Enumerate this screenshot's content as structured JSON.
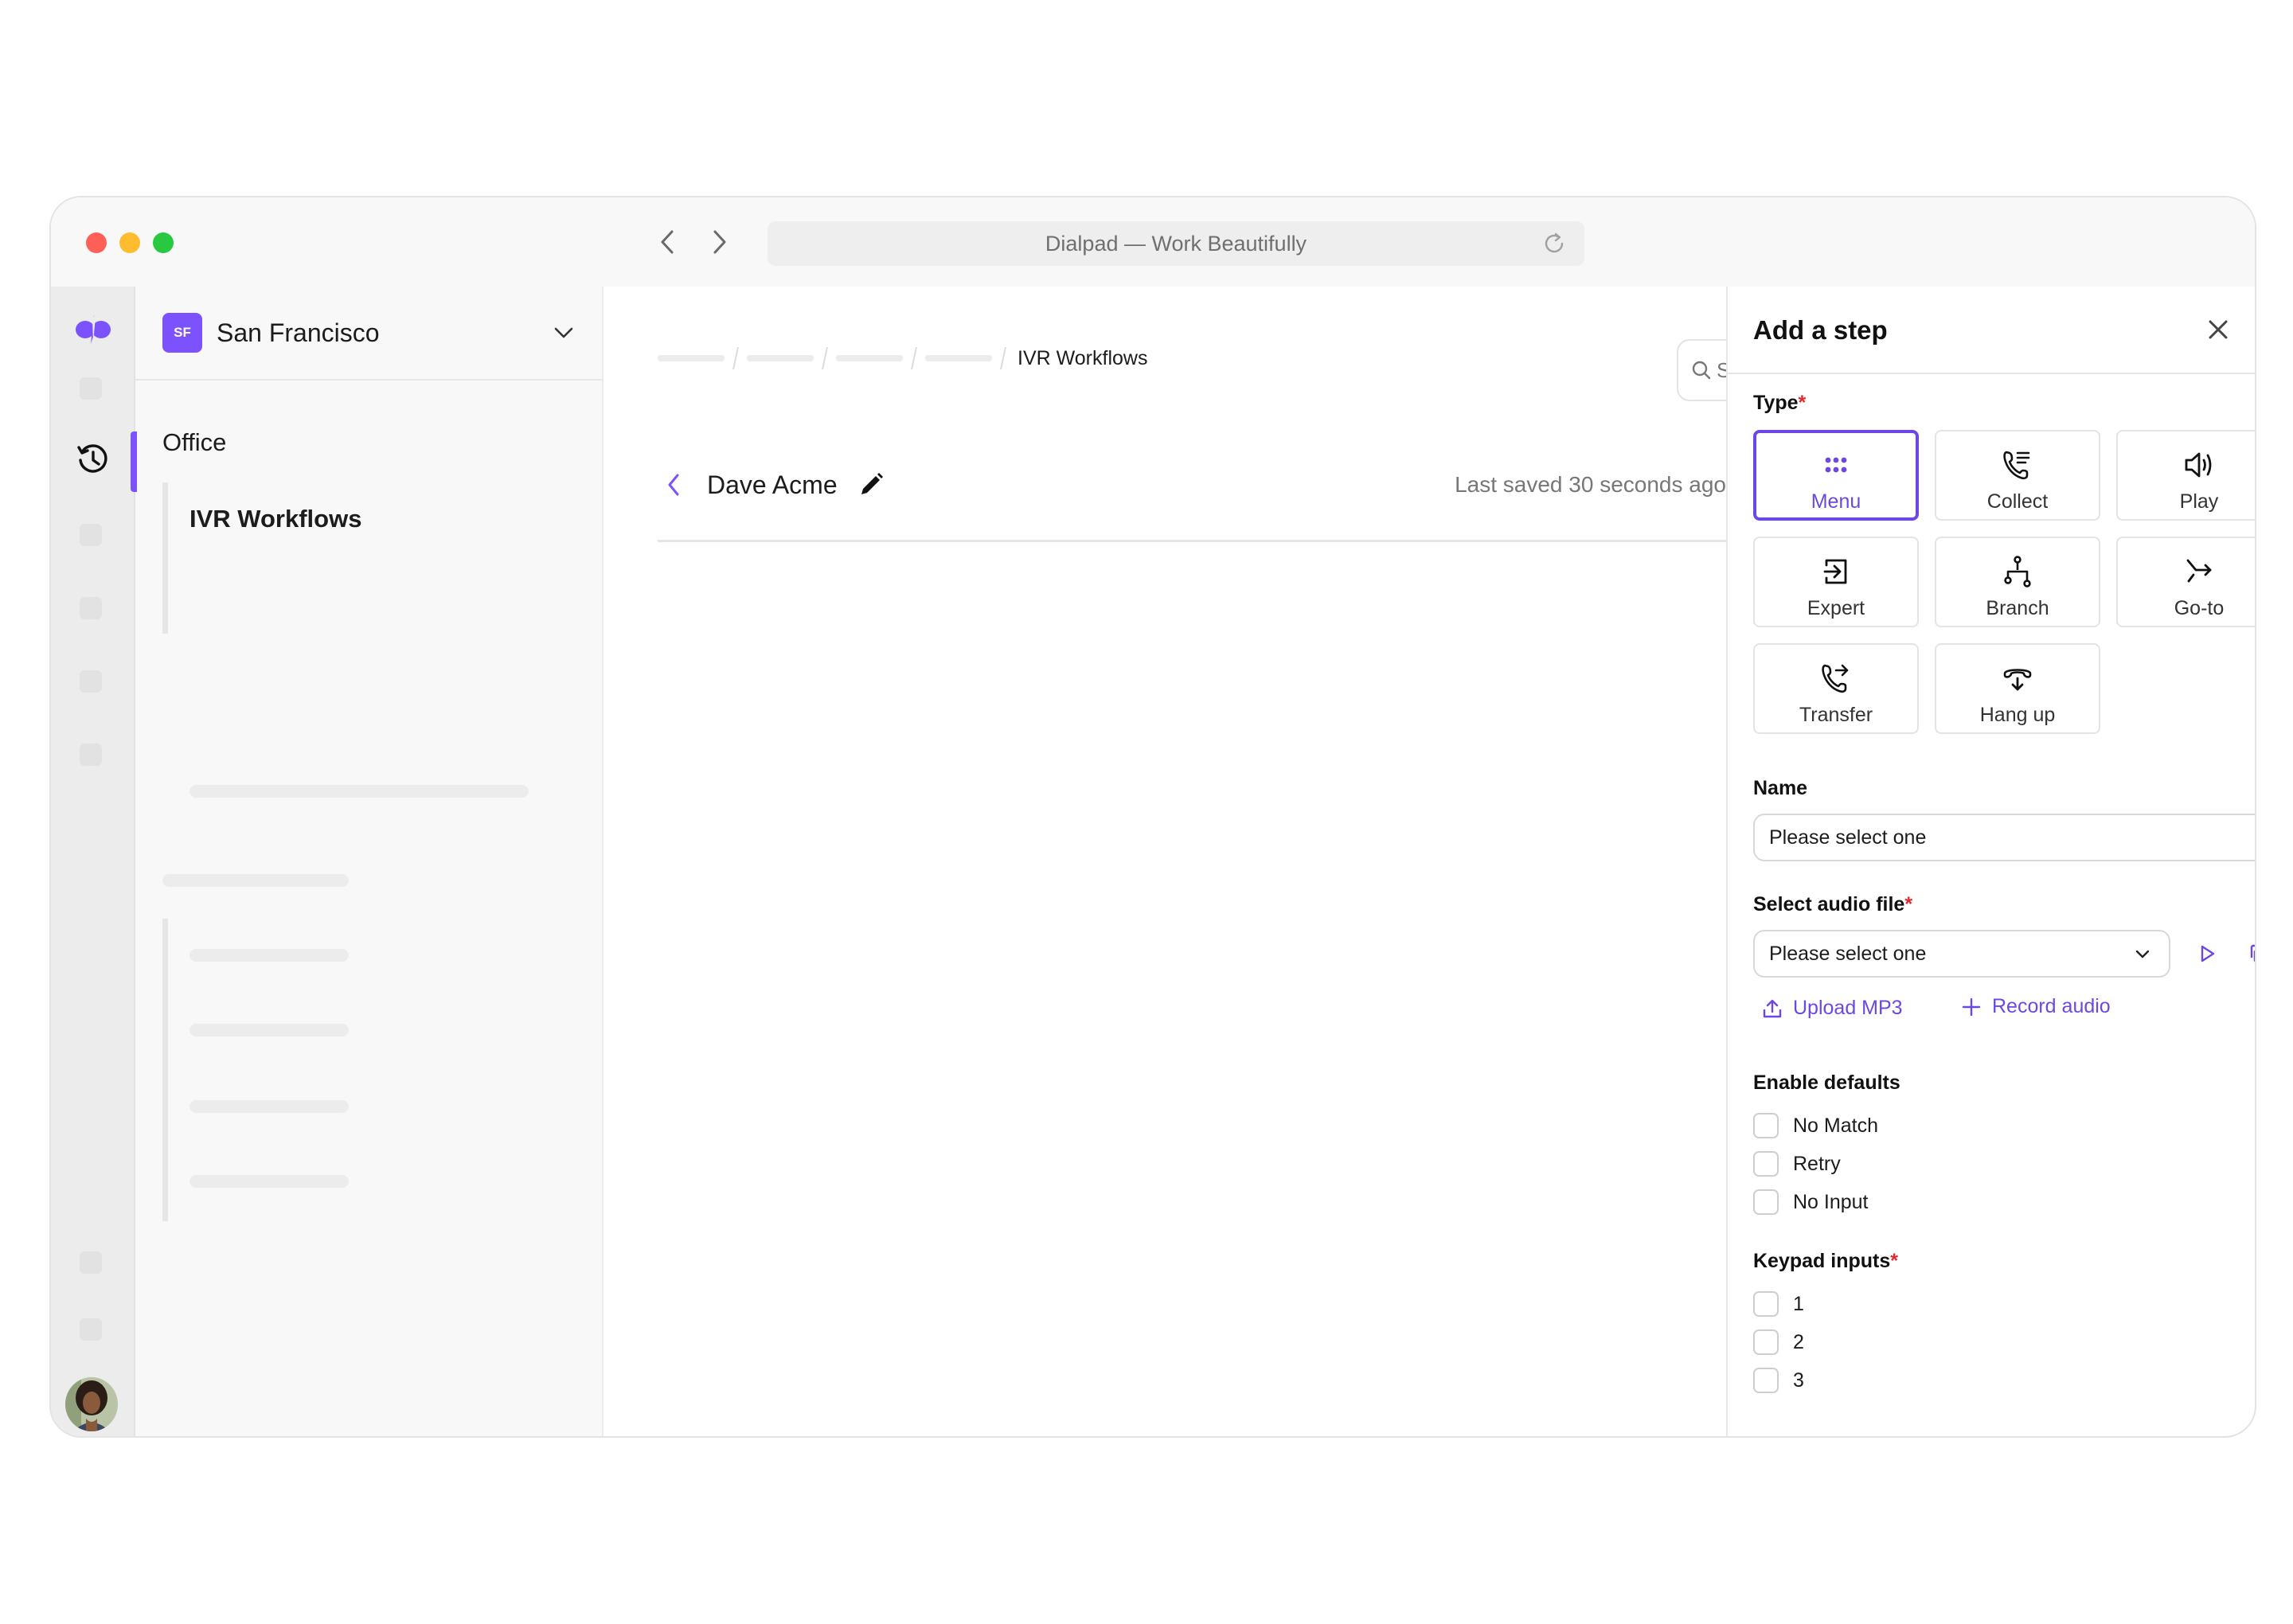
{
  "browser": {
    "url_title": "Dialpad — Work Beautifully",
    "back_icon": "chevron-left-icon",
    "forward_icon": "chevron-right-icon",
    "reload_icon": "reload-icon"
  },
  "rail": {
    "logo_icon": "dialpad-logo-icon",
    "active_icon": "history-icon",
    "avatar": "user-avatar"
  },
  "sidebar": {
    "workspace": {
      "initials": "SF",
      "name": "San Francisco",
      "badge_color": "#7c52ff"
    },
    "section_title": "Office",
    "active_item": "IVR Workflows"
  },
  "main": {
    "breadcrumb": {
      "current": "IVR Workflows"
    },
    "search_placeholder": "Search",
    "workflow_title": "Dave Acme",
    "last_saved": "Last saved 30 seconds ago"
  },
  "panel": {
    "title": "Add a step",
    "type_label": "Type",
    "required_mark": "*",
    "types": [
      {
        "label": "Menu",
        "icon": "keypad-dots-icon",
        "selected": true
      },
      {
        "label": "Collect",
        "icon": "phone-list-icon",
        "selected": false
      },
      {
        "label": "Play",
        "icon": "speaker-icon",
        "selected": false
      },
      {
        "label": "Expert",
        "icon": "enter-box-icon",
        "selected": false
      },
      {
        "label": "Branch",
        "icon": "branch-icon",
        "selected": false
      },
      {
        "label": "Go-to",
        "icon": "merge-arrow-icon",
        "selected": false
      },
      {
        "label": "Transfer",
        "icon": "phone-forward-icon",
        "selected": false
      },
      {
        "label": "Hang up",
        "icon": "hang-up-icon",
        "selected": false
      }
    ],
    "name_label": "Name",
    "name_value": "Please select one",
    "audio_label": "Select audio file",
    "audio_value": "Please select one",
    "upload_label": "Upload MP3",
    "record_label": "Record audio",
    "defaults_label": "Enable defaults",
    "defaults": [
      {
        "label": "No Match",
        "checked": false
      },
      {
        "label": "Retry",
        "checked": false
      },
      {
        "label": "No Input",
        "checked": false
      }
    ],
    "keypad_label": "Keypad inputs",
    "keypad": [
      {
        "label": "1",
        "checked": false
      },
      {
        "label": "2",
        "checked": false
      },
      {
        "label": "3",
        "checked": false
      }
    ]
  },
  "colors": {
    "accent": "#6c47e6",
    "brand": "#7c52ff",
    "required": "#e5262d"
  }
}
